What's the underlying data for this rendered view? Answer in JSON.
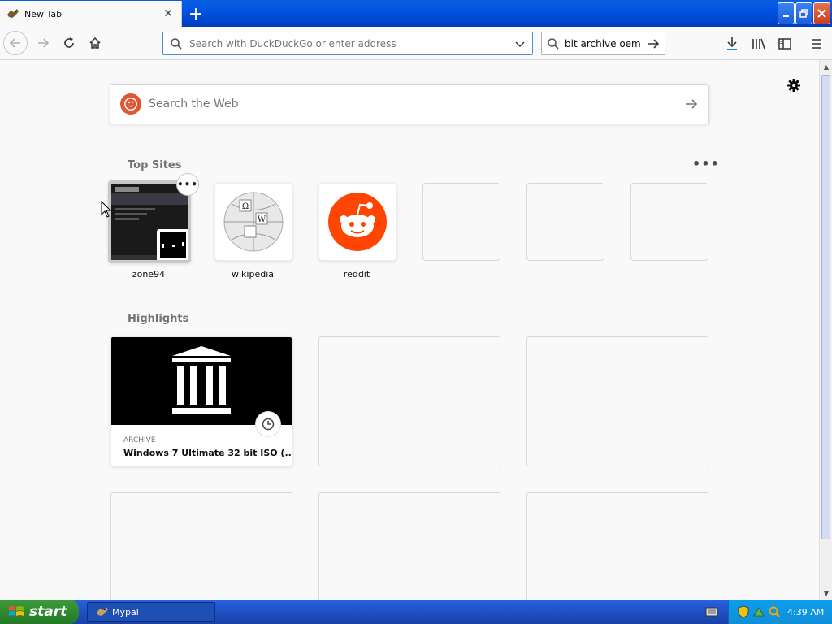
{
  "browser": {
    "tab": {
      "title": "New Tab",
      "favicon": "mypal-icon"
    },
    "new_tab_label": "+",
    "url_placeholder": "Search with DuckDuckGo or enter address",
    "search_value": "bit archive oem"
  },
  "newtab": {
    "search_placeholder": "Search the Web",
    "top_sites_title": "Top Sites",
    "top_sites": [
      {
        "label": "zone94"
      },
      {
        "label": "wikipedia"
      },
      {
        "label": "reddit"
      },
      {
        "label": ""
      },
      {
        "label": ""
      },
      {
        "label": ""
      }
    ],
    "highlights_title": "Highlights",
    "highlights": [
      {
        "context": "ARCHIVE",
        "title": "Windows 7 Ultimate 32 bit ISO (..."
      }
    ]
  },
  "taskbar": {
    "start_label": "start",
    "task_label": "Mypal",
    "clock": "4:39 AM"
  },
  "colors": {
    "reddit": "#ff4500",
    "ddg": "#de5833",
    "xp_blue": "#245edb",
    "xp_green": "#3c9a3c"
  }
}
